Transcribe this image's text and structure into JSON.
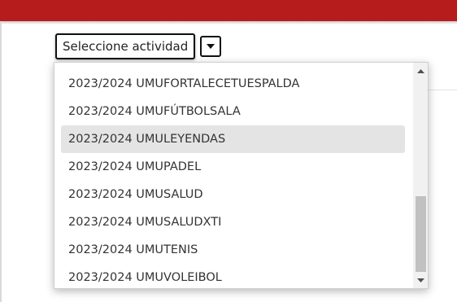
{
  "select": {
    "label": "Seleccione actividad",
    "arrow_icon": "caret-down-icon"
  },
  "dropdown": {
    "options": [
      "2023/2024 UMUFORTALECETUESPALDA",
      "2023/2024 UMUFÚTBOLSALA",
      "2023/2024 UMULEYENDAS",
      "2023/2024 UMUPADEL",
      "2023/2024 UMUSALUD",
      "2023/2024 UMUSALUDXTI",
      "2023/2024 UMUTENIS",
      "2023/2024 UMUVOLEIBOL"
    ],
    "highlighted_index": 2
  },
  "colors": {
    "header": "#b71c1c",
    "highlight": "#e4e4e4",
    "text": "#333333"
  }
}
